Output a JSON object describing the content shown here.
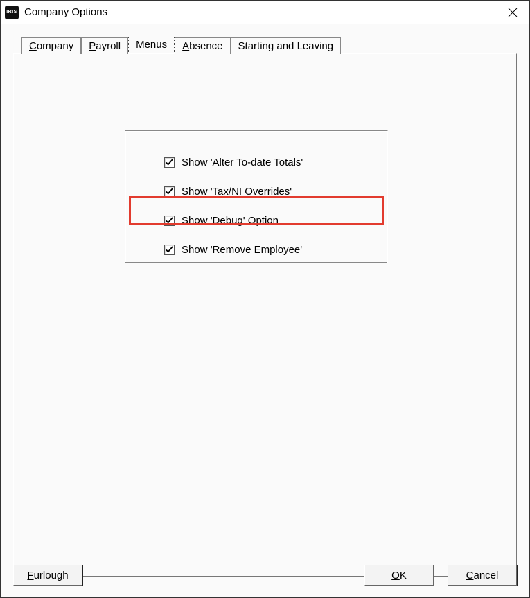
{
  "window": {
    "app_icon_text": "IRIS",
    "title": "Company Options"
  },
  "tabs": [
    {
      "label": "Company",
      "accel_index": 0,
      "selected": false
    },
    {
      "label": "Payroll",
      "accel_index": 0,
      "selected": false
    },
    {
      "label": "Menus",
      "accel_index": 0,
      "selected": true
    },
    {
      "label": "Absence",
      "accel_index": 0,
      "selected": false
    },
    {
      "label": "Starting and Leaving",
      "accel_index": -1,
      "selected": false
    }
  ],
  "checks": [
    {
      "label": "Show 'Alter To-date Totals'",
      "checked": true
    },
    {
      "label": "Show 'Tax/NI Overrides'",
      "checked": true
    },
    {
      "label": "Show 'Debug' Option",
      "checked": true,
      "highlighted": true
    },
    {
      "label": "Show 'Remove Employee'",
      "checked": true
    }
  ],
  "buttons": {
    "furlough": {
      "label": "Furlough",
      "accel_index": 0
    },
    "ok": {
      "label": "OK",
      "accel_index": 0
    },
    "cancel": {
      "label": "Cancel",
      "accel_index": 0
    }
  }
}
